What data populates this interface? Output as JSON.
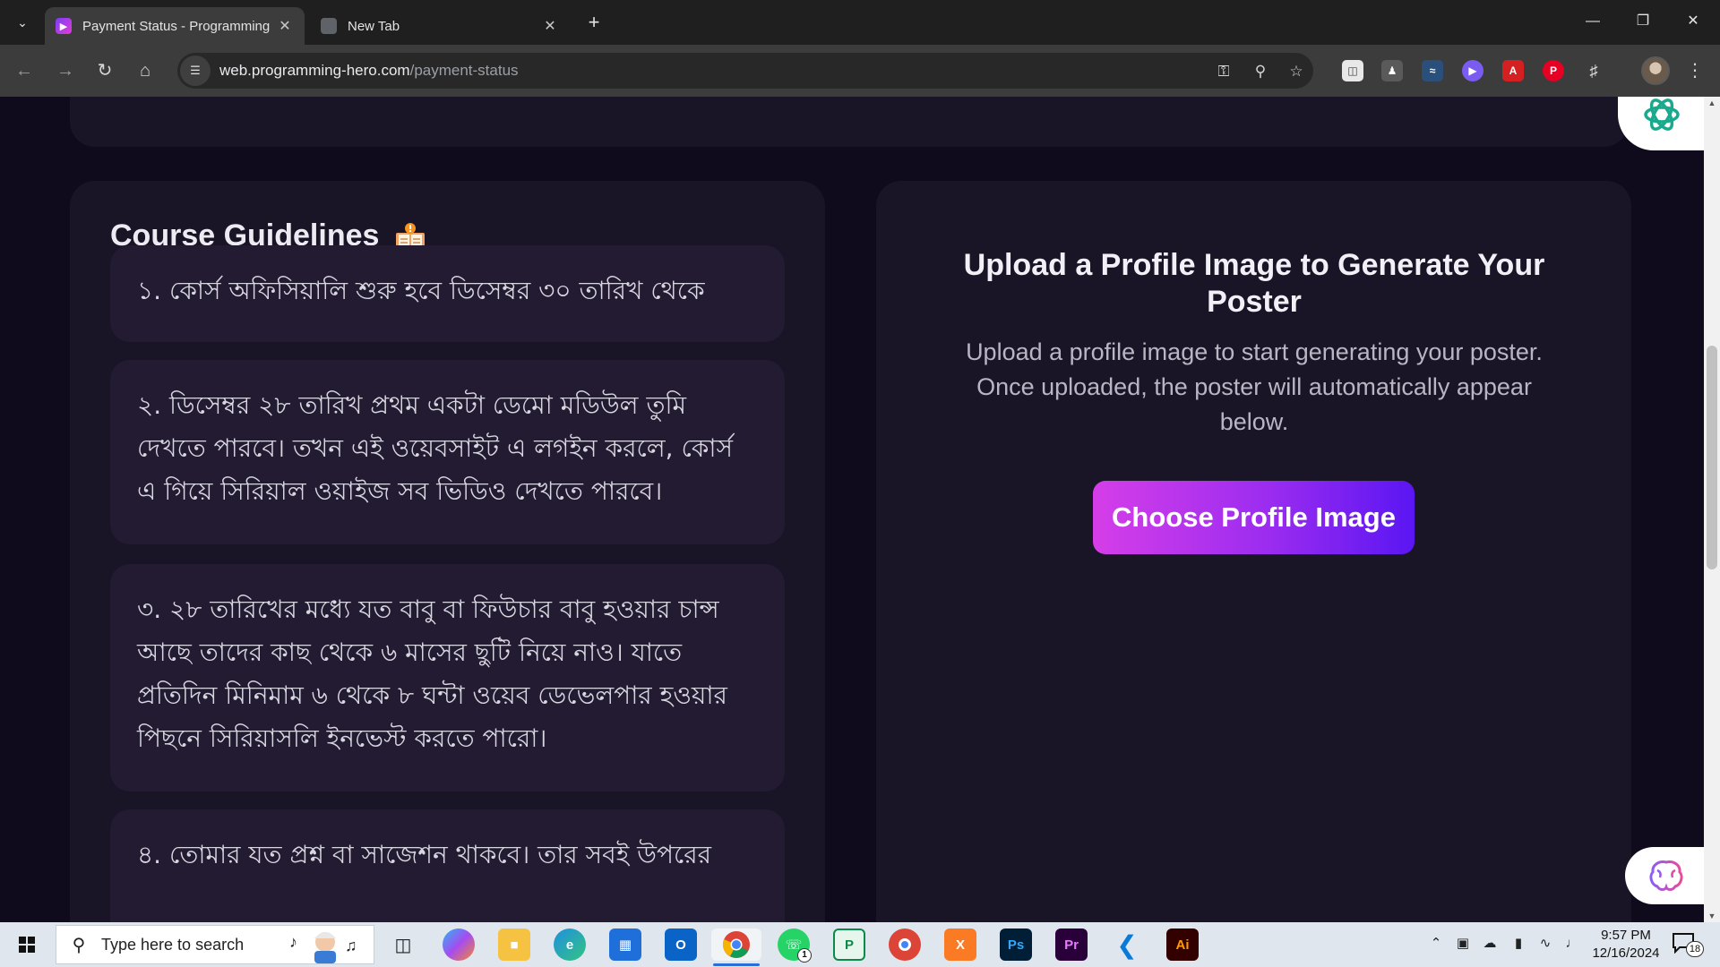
{
  "browser": {
    "tabs": [
      {
        "title": "Payment Status - Programming",
        "active": true,
        "favicon": "programming-hero-icon"
      },
      {
        "title": "New Tab",
        "active": false,
        "favicon": "chrome-icon"
      }
    ],
    "address": {
      "host": "web.programming-hero.com",
      "path": "/payment-status"
    }
  },
  "page": {
    "guidelines": {
      "title": "Course Guidelines",
      "items": [
        "১. কোর্স অফিসিয়ালি শুরু হবে ডিসেম্বর ৩০ তারিখ থেকে",
        "২. ডিসেম্বর ২৮ তারিখ প্রথম একটা ডেমো মডিউল তুমি দেখতে পারবে। তখন এই ওয়েবসাইট এ লগইন করলে, কোর্স এ গিয়ে সিরিয়াল ওয়াইজ সব ভিডিও দেখতে পারবে।",
        "৩. ২৮ তারিখের মধ্যে যত বাবু বা ফিউচার বাবু হওয়ার চান্স আছে তাদের কাছ থেকে ৬ মাসের ছুটি নিয়ে নাও। যাতে প্রতিদিন মিনিমাম ৬ থেকে ৮ ঘন্টা ওয়েব ডেভেলপার হওয়ার পিছনে সিরিয়াসলি ইনভেস্ট করতে পারো।",
        "৪. তোমার যত প্রশ্ন বা সাজেশন থাকবে। তার সবই উপরের"
      ]
    },
    "upload": {
      "title": "Upload a Profile Image to Generate Your Poster",
      "description": "Upload a profile image to start generating your poster. Once uploaded, the poster will automatically appear below.",
      "button": "Choose Profile Image"
    }
  },
  "taskbar": {
    "search_placeholder": "Type here to search",
    "time": "9:57 PM",
    "date": "12/16/2024",
    "whatsapp_badge": "1",
    "notification_count": "18"
  },
  "colors": {
    "accent_start": "#d53ee8",
    "accent_end": "#5a16f2",
    "page_bg": "#0f0a1c",
    "card_bg": "#1a1427"
  }
}
